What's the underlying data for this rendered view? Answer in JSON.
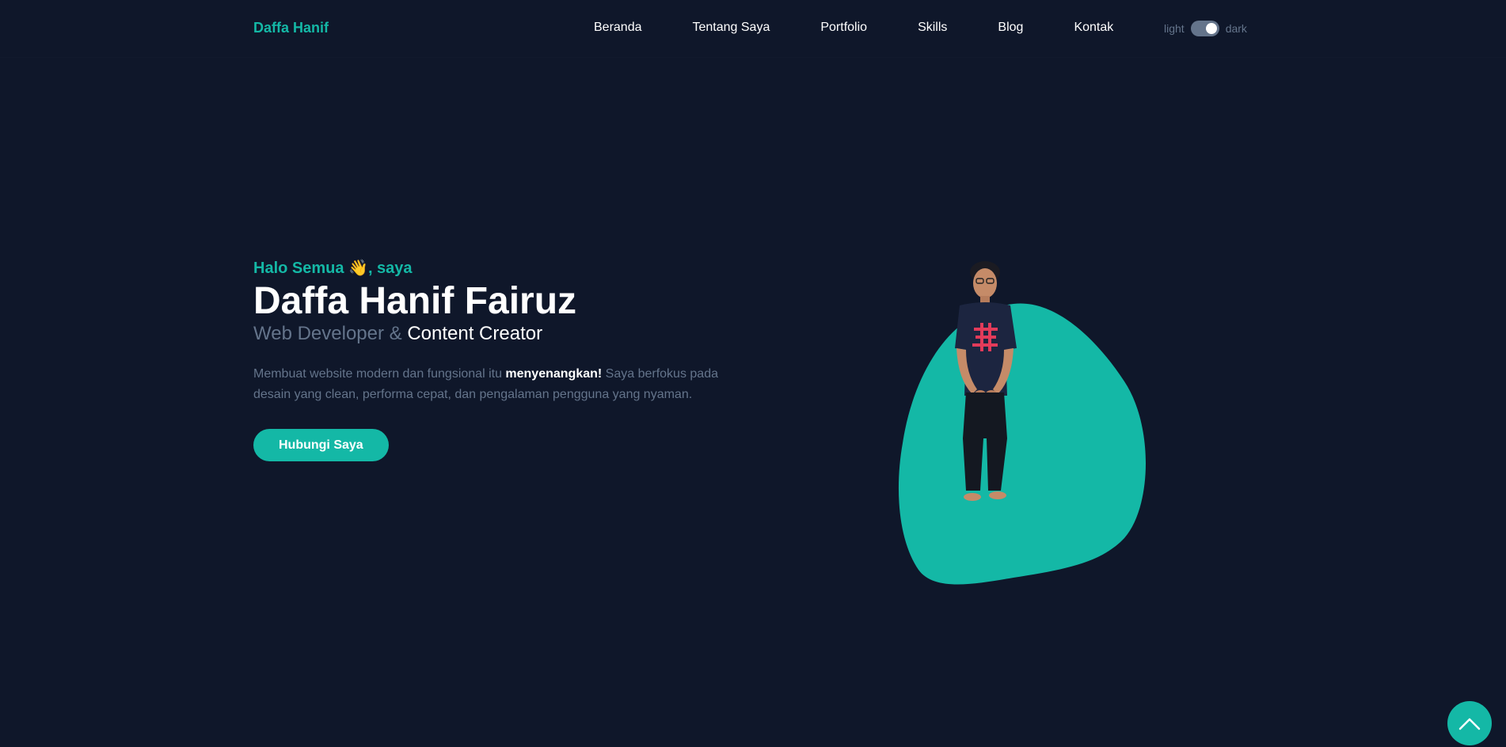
{
  "header": {
    "brand": "Daffa Hanif",
    "nav": [
      "Beranda",
      "Tentang Saya",
      "Portfolio",
      "Skills",
      "Blog",
      "Kontak"
    ],
    "theme_light": "light",
    "theme_dark": "dark",
    "theme_mode": "dark"
  },
  "hero": {
    "greeting": "Halo Semua 👋, saya",
    "name": "Daffa Hanif Fairuz",
    "role_part1": "Web Developer & ",
    "role_part2": "Content Creator",
    "desc_before": "Membuat website modern dan fungsional itu ",
    "desc_bold": "menyenangkan!",
    "desc_after": " Saya berfokus pada desain yang clean, performa cepat, dan pengalaman pengguna yang nyaman.",
    "cta": "Hubungi Saya"
  },
  "icons": {
    "back_to_top": "chevron-up-icon",
    "hero_illustration": "person-photo"
  },
  "colors": {
    "background": "#0f172a",
    "accent": "#14b8a6",
    "muted": "#64748b",
    "text": "#ffffff"
  }
}
